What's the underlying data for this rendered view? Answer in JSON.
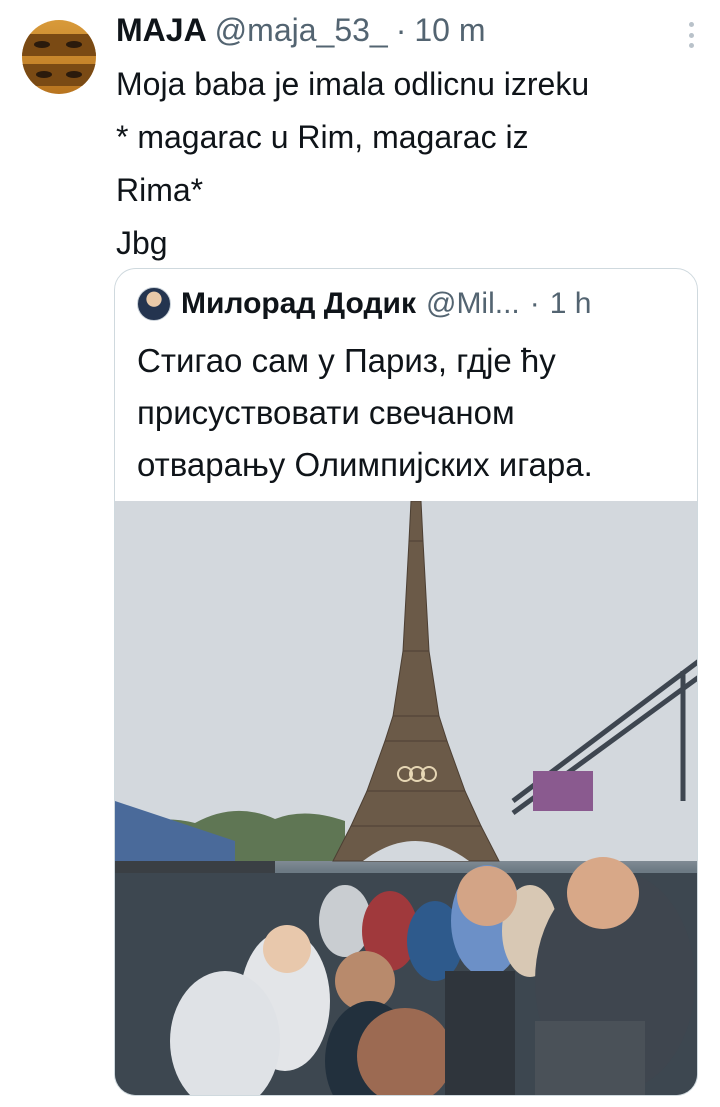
{
  "tweet": {
    "display_name": "MAJA",
    "handle": "@maja_53_",
    "separator": "·",
    "time": "10 m",
    "text_lines": [
      "Moja baba je imala odlicnu izreku",
      "* magarac u Rim, magarac iz",
      "Rima*",
      "Jbg"
    ]
  },
  "quoted": {
    "display_name": "Милорад Додик",
    "handle": "@Mil...",
    "separator": "·",
    "time": "1 h",
    "text_lines": [
      "Стигао сам у Париз, гдје ћу",
      "присуствовати свечаном",
      "отварању Олимпијских игара."
    ]
  },
  "icons": {
    "more": "more-vertical-icon"
  }
}
